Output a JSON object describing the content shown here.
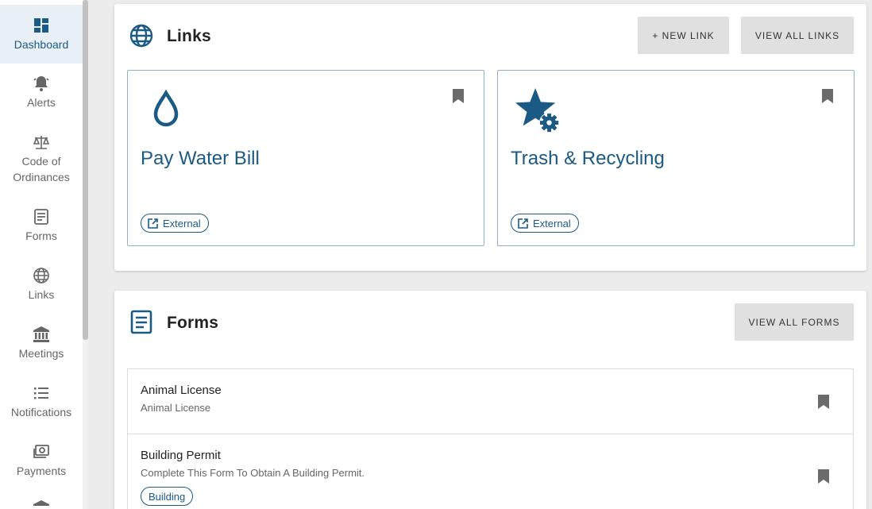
{
  "sidebar": {
    "items": [
      {
        "label": "Dashboard",
        "icon": "dashboard-icon",
        "active": true
      },
      {
        "label": "Alerts",
        "icon": "bell-icon"
      },
      {
        "label": "Code of Ordinances",
        "icon": "scales-icon"
      },
      {
        "label": "Forms",
        "icon": "form-icon"
      },
      {
        "label": "Links",
        "icon": "globe-icon"
      },
      {
        "label": "Meetings",
        "icon": "building-columns-icon"
      },
      {
        "label": "Notifications",
        "icon": "list-icon"
      },
      {
        "label": "Payments",
        "icon": "money-icon"
      }
    ]
  },
  "links": {
    "title": "Links",
    "new_link_label": "+ NEW LINK",
    "view_all_label": "VIEW ALL LINKS",
    "cards": [
      {
        "title": "Pay Water Bill",
        "badge": "External",
        "icon": "water-drop-icon"
      },
      {
        "title": "Trash & Recycling",
        "badge": "External",
        "icon": "star-gear-icon"
      }
    ]
  },
  "forms": {
    "title": "Forms",
    "view_all_label": "VIEW ALL FORMS",
    "items": [
      {
        "title": "Animal License",
        "subtitle": "Animal License"
      },
      {
        "title": "Building Permit",
        "subtitle": "Complete This Form To Obtain A Building Permit.",
        "tag": "Building"
      }
    ]
  },
  "colors": {
    "accent": "#1b5a85",
    "active_bg": "#e8f0f5",
    "button_bg": "#e0e0e0",
    "page_bg": "#ececec"
  }
}
